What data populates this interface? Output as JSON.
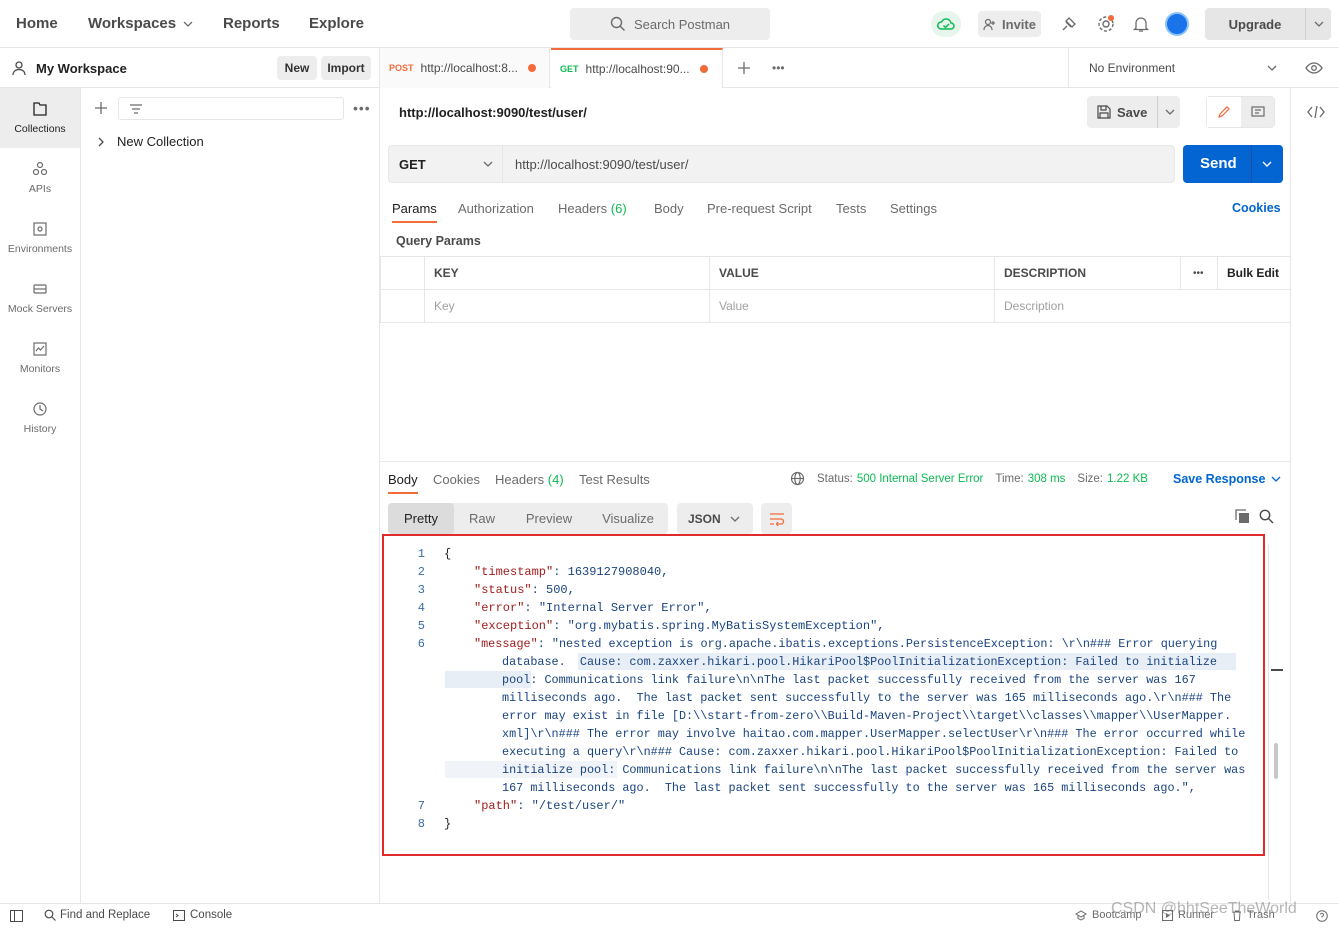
{
  "header": {
    "nav": [
      "Home",
      "Workspaces",
      "Reports",
      "Explore"
    ],
    "search_placeholder": "Search Postman",
    "invite_label": "Invite",
    "upgrade_label": "Upgrade"
  },
  "workspace": {
    "name": "My Workspace",
    "new_label": "New",
    "import_label": "Import"
  },
  "sidebar": {
    "items": [
      {
        "label": "Collections",
        "icon": "collections-icon"
      },
      {
        "label": "APIs",
        "icon": "apis-icon"
      },
      {
        "label": "Environments",
        "icon": "environments-icon"
      },
      {
        "label": "Mock Servers",
        "icon": "mock-servers-icon"
      },
      {
        "label": "Monitors",
        "icon": "monitors-icon"
      },
      {
        "label": "History",
        "icon": "history-icon"
      }
    ],
    "collection_name": "New Collection"
  },
  "tabs": [
    {
      "method": "POST",
      "title": "http://localhost:8...",
      "method_color": "#f26b3a"
    },
    {
      "method": "GET",
      "title": "http://localhost:90...",
      "method_color": "#0cbb52"
    }
  ],
  "environment": "No Environment",
  "request": {
    "name": "http://localhost:9090/test/user/",
    "method": "GET",
    "url": "http://localhost:9090/test/user/",
    "save_label": "Save",
    "send_label": "Send",
    "tabs": [
      "Params",
      "Authorization",
      "Headers",
      "Body",
      "Pre-request Script",
      "Tests",
      "Settings"
    ],
    "headers_count": "(6)",
    "cookies_label": "Cookies",
    "query_params_label": "Query Params",
    "params_columns": [
      "KEY",
      "VALUE",
      "DESCRIPTION"
    ],
    "bulk_edit_label": "Bulk Edit",
    "params_placeholders": [
      "Key",
      "Value",
      "Description"
    ]
  },
  "response": {
    "tabs": [
      "Body",
      "Cookies",
      "Headers",
      "Test Results"
    ],
    "headers_count": "(4)",
    "status_label": "Status:",
    "status_value": "500 Internal Server Error",
    "time_label": "Time:",
    "time_value": "308 ms",
    "size_label": "Size:",
    "size_value": "1.22 KB",
    "save_response_label": "Save Response",
    "views": [
      "Pretty",
      "Raw",
      "Preview",
      "Visualize"
    ],
    "format": "JSON",
    "line_numbers": [
      "1",
      "2",
      "3",
      "4",
      "5",
      "6",
      "7",
      "8"
    ],
    "code_lines": [
      "{",
      "\"timestamp\": 1639127908040,",
      "\"status\": 500,",
      "\"error\": \"Internal Server Error\",",
      "\"exception\": \"org.mybatis.spring.MyBatisSystemException\",",
      "\"message\": \"nested exception is org.apache.ibatis.exceptions.PersistenceException: \\r\\n### Error querying",
      "database.  Cause: com.zaxxer.hikari.pool.HikariPool$PoolInitializationException: Failed to initialize",
      "pool: Communications link failure\\n\\nThe last packet successfully received from the server was 167",
      "milliseconds ago.  The last packet sent successfully to the server was 165 milliseconds ago.\\r\\n### The",
      "error may exist in file [D:\\\\start-from-zero\\\\Build-Maven-Project\\\\target\\\\classes\\\\mapper\\\\UserMapper.",
      "xml]\\r\\n### The error may involve haitao.com.mapper.UserMapper.selectUser\\r\\n### The error occurred while",
      "executing a query\\r\\n### Cause: com.zaxxer.hikari.pool.HikariPool$PoolInitializationException: Failed to",
      "initialize pool: Communications link failure\\n\\nThe last packet successfully received from the server was",
      "167 milliseconds ago.  The last packet sent successfully to the server was 165 milliseconds ago.\",",
      "\"path\": \"/test/user/\"",
      "}"
    ]
  },
  "statusbar": {
    "find_replace": "Find and Replace",
    "console": "Console",
    "bootcamp": "Bootcamp",
    "runner": "Runner",
    "trash": "Trash",
    "watermark": "CSDN @hhtSeeTheWorld"
  }
}
